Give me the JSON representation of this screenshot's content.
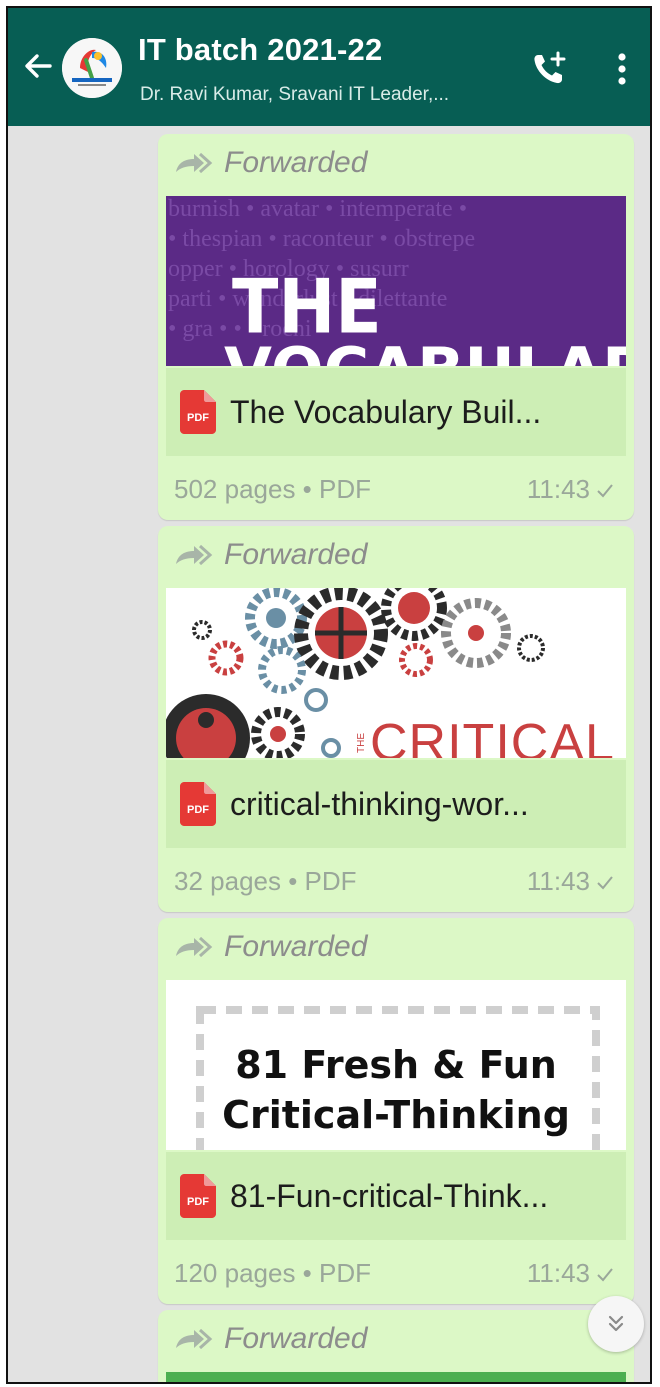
{
  "header": {
    "title": "IT batch 2021-22",
    "subtitle": "Dr. Ravi Kumar, Sravani IT Leader,...",
    "back_icon": "arrow-left-icon",
    "avatar_icon": "group-logo",
    "call_icon": "add-call-icon",
    "menu_icon": "more-vert-icon"
  },
  "messages": [
    {
      "forwarded_label": "Forwarded",
      "preview": {
        "big_text_1": "THE",
        "big_text_2": "VOCABULARY",
        "bg_words_1": "burnish • avatar • intemperate •",
        "bg_words_2": "• thespian • raconteur • obstrepe",
        "bg_words_3": "opper • horology • susurr",
        "bg_words_4": "parti • wanderlust • dilettante",
        "bg_words_5": "• gra • • • rochi"
      },
      "badge": "PDF",
      "file_name": "The Vocabulary Buil...",
      "meta": "502 pages • PDF",
      "time": "11:43"
    },
    {
      "forwarded_label": "Forwarded",
      "preview": {
        "text": "CRITICAL",
        "side_text": "THE"
      },
      "badge": "PDF",
      "file_name": "critical-thinking-wor...",
      "meta": "32 pages • PDF",
      "time": "11:43"
    },
    {
      "forwarded_label": "Forwarded",
      "preview": {
        "line1": "81 Fresh & Fun",
        "line2": "Critical-Thinking"
      },
      "badge": "PDF",
      "file_name": "81-Fun-critical-Think...",
      "meta": "120 pages • PDF",
      "time": "11:43"
    },
    {
      "forwarded_label": "Forwarded"
    }
  ],
  "colors": {
    "header": "#075e54",
    "bubble": "#dcf8c6",
    "file_row": "#cdeeb5",
    "pdf_red": "#e53935",
    "vocab_purple": "#5b2a86"
  },
  "scroll_button_icon": "double-chevron-down-icon"
}
